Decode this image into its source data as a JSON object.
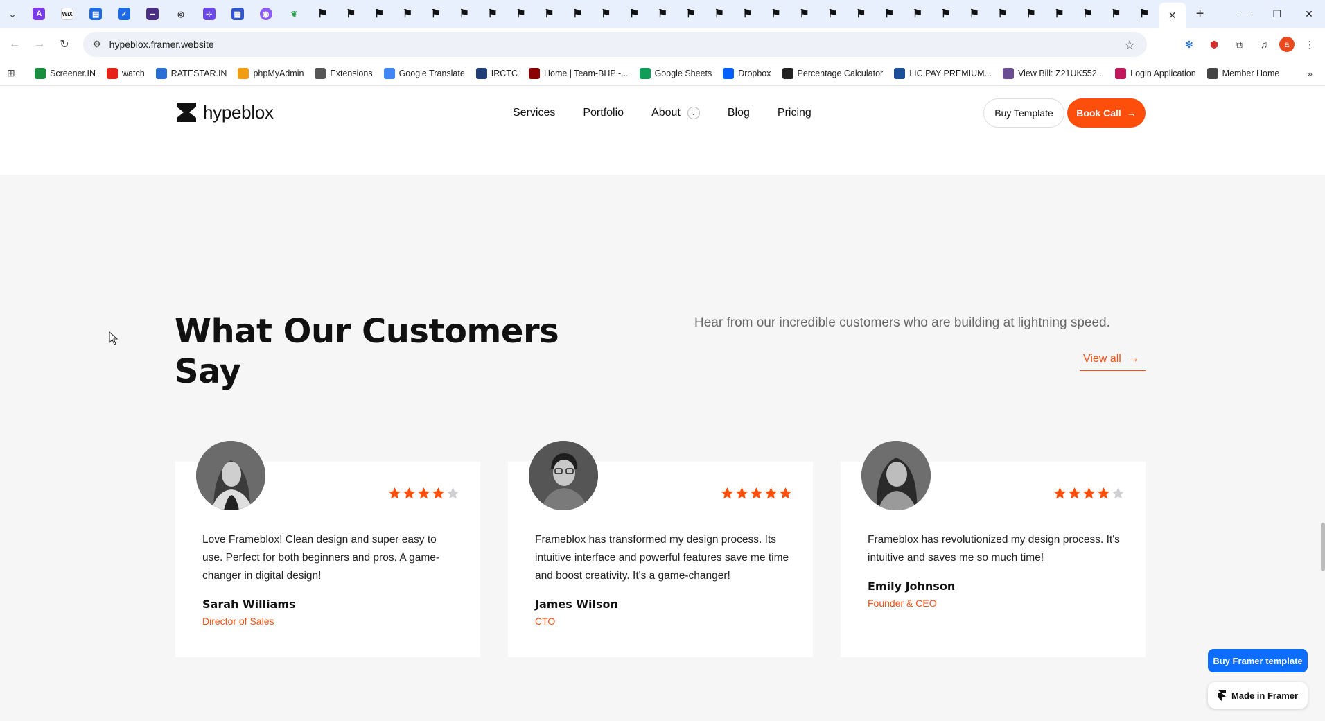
{
  "browser": {
    "url": "hypeblox.framer.website",
    "tab_count_framer": 30,
    "bookmarks": [
      {
        "label": "Screener.IN",
        "color": "#1a8d3e"
      },
      {
        "label": "watch",
        "color": "#e62117"
      },
      {
        "label": "RATESTAR.IN",
        "color": "#2a6fd6"
      },
      {
        "label": "phpMyAdmin",
        "color": "#f29c11"
      },
      {
        "label": "Extensions",
        "color": "#555555"
      },
      {
        "label": "Google Translate",
        "color": "#4285f4"
      },
      {
        "label": "IRCTC",
        "color": "#213d77"
      },
      {
        "label": "Home | Team-BHP -...",
        "color": "#8b0000"
      },
      {
        "label": "Google Sheets",
        "color": "#0f9d58"
      },
      {
        "label": "Dropbox",
        "color": "#0061ff"
      },
      {
        "label": "Percentage Calculator",
        "color": "#222222"
      },
      {
        "label": "LIC PAY PREMIUM...",
        "color": "#1b4f9c"
      },
      {
        "label": "View Bill: Z21UK552...",
        "color": "#6a4c93"
      },
      {
        "label": "Login Application",
        "color": "#c2185b"
      },
      {
        "label": "Member Home",
        "color": "#444444"
      }
    ],
    "avatar_letter": "a"
  },
  "site": {
    "logo": "hypeblox",
    "nav": [
      "Services",
      "Portfolio",
      "About",
      "Blog",
      "Pricing"
    ],
    "buy_template": "Buy Template",
    "book_call": "Book Call",
    "accent": "#fd4e0c"
  },
  "testimonials": {
    "title": "What Our Customers Say",
    "subtitle": "Hear from our incredible customers who are building at lightning speed.",
    "view_all": "View all",
    "cards": [
      {
        "quote": "Love Frameblox! Clean design and super easy to use. Perfect for both beginners and pros. A game-changer in digital design!",
        "name": "Sarah Williams",
        "role": "Director of Sales",
        "rating": 4
      },
      {
        "quote": "Frameblox has transformed my design process. Its intuitive interface and powerful features save me time and boost creativity. It's a game-changer!",
        "name": "James Wilson",
        "role": "CTO",
        "rating": 5
      },
      {
        "quote": "Frameblox has revolutionized my design process. It's intuitive and saves me so much time!",
        "name": "Emily Johnson",
        "role": "Founder & CEO",
        "rating": 4
      }
    ]
  },
  "framer": {
    "buy": "Buy Framer template",
    "made": "Made in Framer"
  }
}
